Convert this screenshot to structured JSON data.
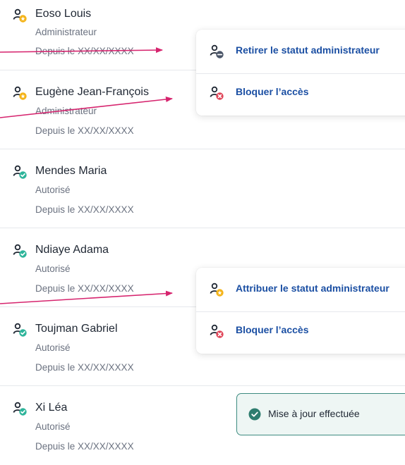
{
  "users": [
    {
      "name": "Eoso Louis",
      "role": "Administrateur",
      "since": "Depuis le XX/XX/XXXX",
      "status": "admin"
    },
    {
      "name": "Eugène Jean-François",
      "role": "Administrateur",
      "since": "Depuis le XX/XX/XXXX",
      "status": "admin"
    },
    {
      "name": "Mendes Maria",
      "role": "Autorisé",
      "since": "Depuis le XX/XX/XXXX",
      "status": "authorized"
    },
    {
      "name": "Ndiaye Adama",
      "role": "Autorisé",
      "since": "Depuis le XX/XX/XXXX",
      "status": "authorized"
    },
    {
      "name": "Toujman Gabriel",
      "role": "Autorisé",
      "since": "Depuis le XX/XX/XXXX",
      "status": "authorized"
    },
    {
      "name": "Xi Léa",
      "role": "Autorisé",
      "since": "Depuis le XX/XX/XXXX",
      "status": "authorized"
    }
  ],
  "admin_menu": {
    "remove_admin_label": "Retirer le statut administrateur",
    "block_label": "Bloquer l’accès"
  },
  "user_menu": {
    "grant_admin_label": "Attribuer le statut administrateur",
    "block_label": "Bloquer l’accès"
  },
  "toast": {
    "message": "Mise à jour effectuée"
  },
  "icons": {
    "user": "user-icon",
    "admin_badge": "star-badge-icon",
    "authorized_badge": "check-badge-icon",
    "remove_badge": "minus-badge-icon",
    "block_badge": "cross-badge-icon",
    "success": "check-circle-icon"
  },
  "colors": {
    "admin_badge": "#f4b41a",
    "authorized_badge": "#2eb49a",
    "remove_badge": "#4a5568",
    "block_badge": "#e0475a",
    "link": "#1b4fa3",
    "annotation_arrow": "#d6246e",
    "toast_border": "#3d8b80",
    "toast_bg": "#eef6f4"
  }
}
